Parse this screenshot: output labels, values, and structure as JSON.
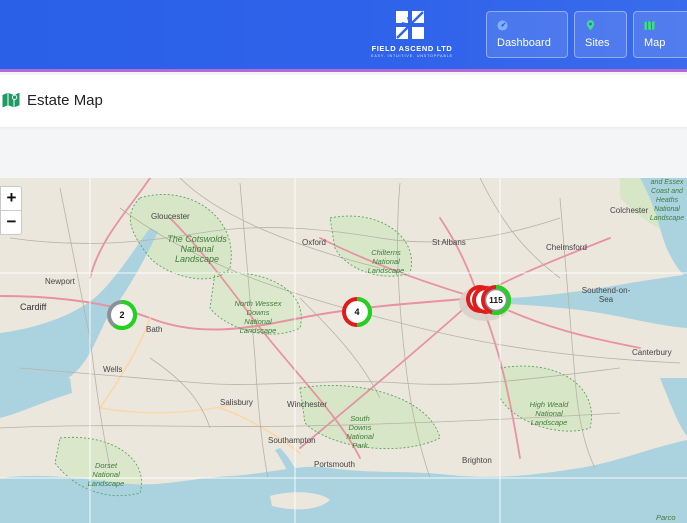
{
  "header": {
    "brand_name": "FIELD ASCEND LTD",
    "brand_tagline": "EASY. INTUITIVE. UNSTOPPABLE",
    "nav": [
      {
        "label": "Dashboard",
        "icon": "dashboard-icon"
      },
      {
        "label": "Sites",
        "icon": "map-pin-icon"
      },
      {
        "label": "Map",
        "icon": "map-icon"
      }
    ]
  },
  "page": {
    "title": "Estate Map",
    "icon": "map-icon"
  },
  "map": {
    "zoom_in": "+",
    "zoom_out": "−",
    "places": [
      "Gloucester",
      "Oxford",
      "St Albans",
      "Chelmsford",
      "Colchester",
      "Newport",
      "Cardiff",
      "Bath",
      "Wells",
      "Salisbury",
      "Winchester",
      "Southampton",
      "Portsmouth",
      "Brighton",
      "Southend-on-Sea",
      "Canterbury"
    ],
    "parks": [
      "The Cotswolds National Landscape",
      "North Wessex Downs National Landscape",
      "Chilterns National Landscape",
      "South Downs National Park",
      "High Weald National Landscape",
      "Dorset National Landscape",
      "and Essex Coast and Heaths National Landscape",
      "Parco"
    ],
    "clusters": [
      {
        "count": "2",
        "share_green": 0.6
      },
      {
        "count": "4",
        "share_green": 0.5
      },
      {
        "count": "115",
        "share_green": 0.55
      }
    ],
    "colors": {
      "marker_green": "#1fd41f",
      "marker_red": "#e01b1b",
      "marker_grey": "#8c8f98"
    }
  }
}
